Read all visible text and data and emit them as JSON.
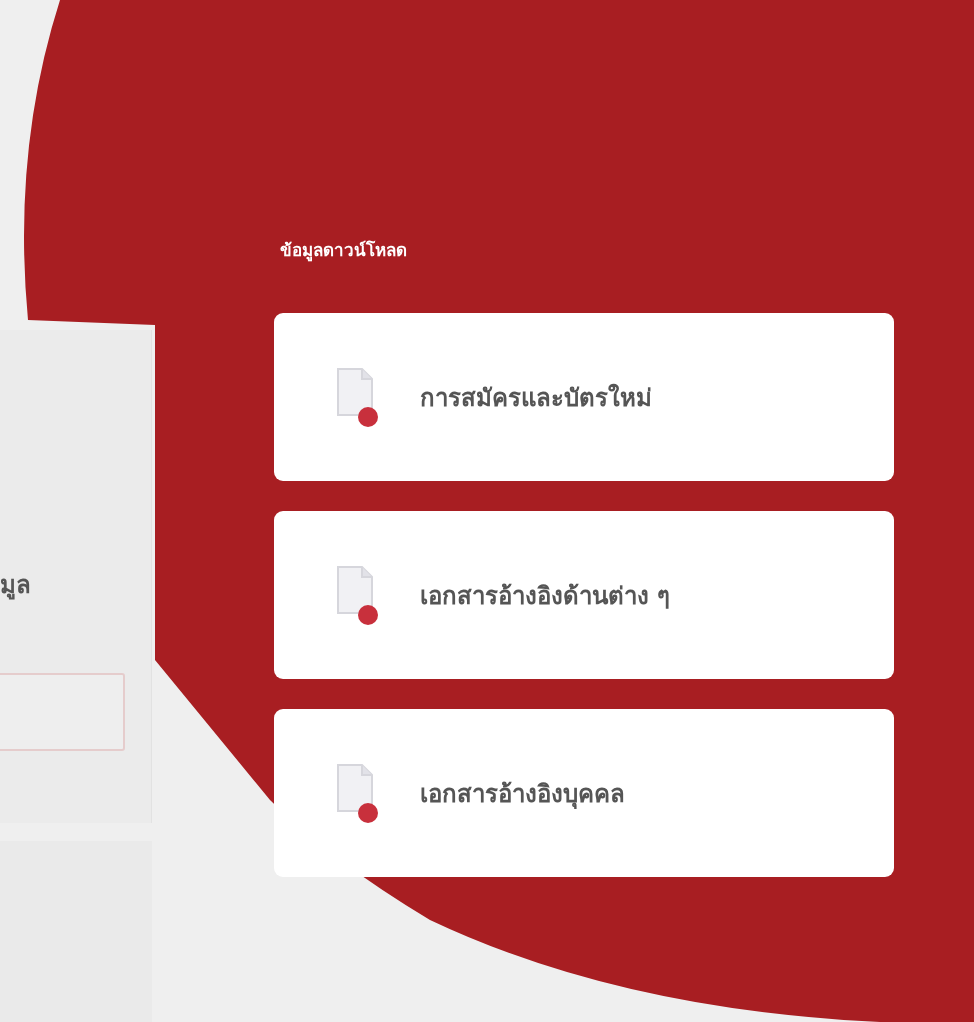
{
  "side_panel": {
    "label": "มูล"
  },
  "downloads": {
    "heading": "ข้อมูลดาวน์โหลด",
    "items": [
      {
        "label": "การสมัครและบัตรใหม่"
      },
      {
        "label": "เอกสารอ้างอิงด้านต่าง ๆ"
      },
      {
        "label": "เอกสารอ้างอิงบุคคล"
      }
    ]
  }
}
